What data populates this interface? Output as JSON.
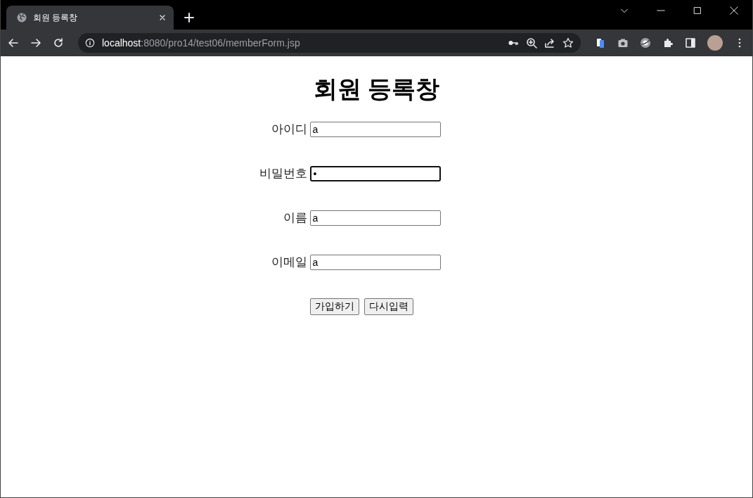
{
  "tabs": [
    {
      "title": "회원 등록창",
      "selected": true
    }
  ],
  "address_bar": {
    "host": "localhost",
    "path": ":8080/pro14/test06/memberForm.jsp"
  },
  "heading": "회원 등록창",
  "fields": [
    {
      "label": "아이디",
      "value": "a",
      "focused": false
    },
    {
      "label": "비밀번호",
      "value": "•",
      "focused": true
    },
    {
      "label": "이름",
      "value": "a",
      "focused": false
    },
    {
      "label": "이메일",
      "value": "a",
      "focused": false
    }
  ],
  "buttons": [
    "가입하기",
    "다시입력"
  ]
}
